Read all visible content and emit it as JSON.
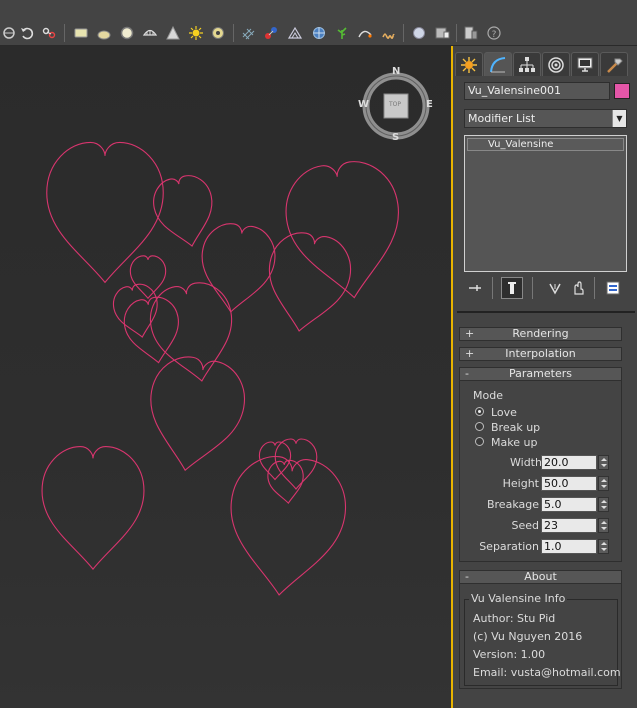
{
  "toolbar": {
    "icons": [
      "viewport-nav-icon",
      "undo-icon",
      "link-icon",
      "rectangle-icon",
      "sphere-icon",
      "circle-icon",
      "shell-icon",
      "cone-icon",
      "sun-icon",
      "torus-icon",
      "grid-icon",
      "bind-icon",
      "geometry-icon",
      "globe-icon",
      "plant-icon",
      "path-icon",
      "spring-icon",
      "render-sphere-icon",
      "render-frame-icon",
      "gallery-icon",
      "help-icon"
    ]
  },
  "viewport": {
    "compass": {
      "n": "N",
      "s": "S",
      "e": "E",
      "w": "W",
      "viewcube_face": "TOP"
    },
    "shape_color": "#d8356e"
  },
  "command_panel": {
    "tabs": [
      "create-tab",
      "modify-tab",
      "hierarchy-tab",
      "motion-tab",
      "display-tab",
      "utilities-tab"
    ],
    "object_name": "Vu_Valensine001",
    "object_color": "#e456a8",
    "modifier_list": "Modifier List",
    "stack_item": "Vu_Valensine"
  },
  "rollouts": {
    "rendering": {
      "sign": "+",
      "label": "Rendering"
    },
    "interpolation": {
      "sign": "+",
      "label": "Interpolation"
    },
    "parameters": {
      "sign": "-",
      "label": "Parameters"
    },
    "about": {
      "sign": "-",
      "label": "About"
    }
  },
  "parameters": {
    "mode_label": "Mode",
    "modes": [
      {
        "label": "Love",
        "checked": true
      },
      {
        "label": "Break up",
        "checked": false
      },
      {
        "label": "Make up",
        "checked": false
      }
    ],
    "fields": [
      {
        "label": "Width",
        "value": "20.0"
      },
      {
        "label": "Height",
        "value": "50.0"
      },
      {
        "label": "Breakage",
        "value": "5.0"
      },
      {
        "label": "Seed",
        "value": "23"
      },
      {
        "label": "Separation",
        "value": "1.0"
      }
    ]
  },
  "about": {
    "group_title": "Vu Valensine Info",
    "author": "Author: Stu Pid",
    "copyright": "(c) Vu Nguyen 2016",
    "version": "Version: 1.00",
    "email": "Email: vusta@hotmail.com"
  }
}
